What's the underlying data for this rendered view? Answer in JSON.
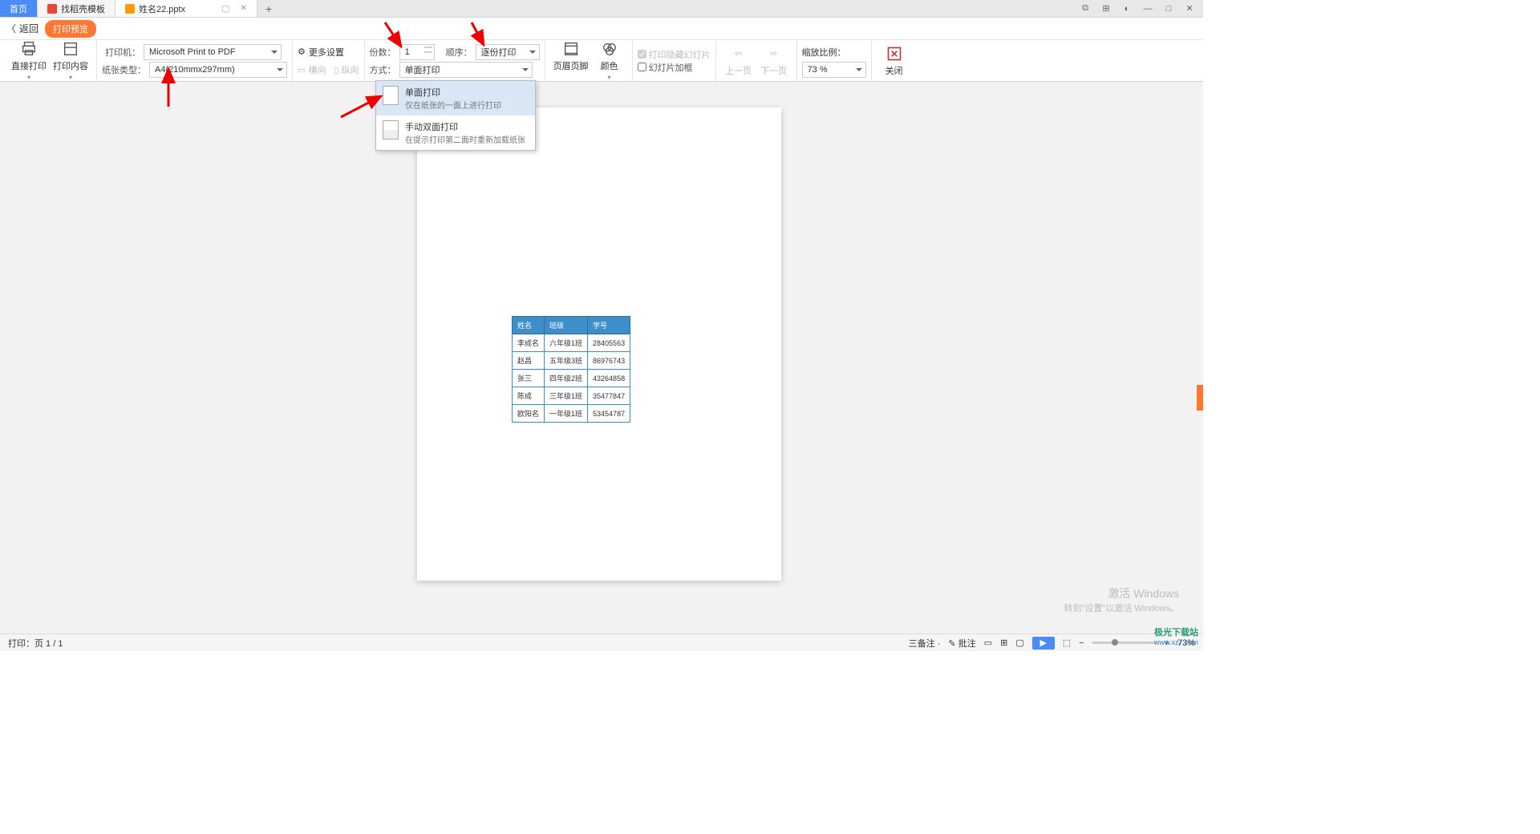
{
  "tabs": {
    "home": "首页",
    "template": "找稻壳模板",
    "active_file": "姓名22.pptx"
  },
  "sub_header": {
    "back": "返回",
    "pill": "打印预览"
  },
  "ribbon": {
    "direct_print": "直接打印",
    "print_content": "打印内容",
    "printer_label": "打印机：",
    "printer_value": "Microsoft Print to PDF",
    "paper_label": "纸张类型：",
    "paper_value": "A4(210mmx297mm)",
    "more_settings": "更多设置",
    "landscape": "横向",
    "portrait": "纵向",
    "copies_label": "份数：",
    "copies_value": "1",
    "order_label": "顺序：",
    "order_value": "逐份打印",
    "mode_label": "方式：",
    "mode_value": "单面打印",
    "header_footer": "页眉页脚",
    "color": "颜色",
    "chk_hidden": "打印隐藏幻灯片",
    "chk_frame": "幻灯片加框",
    "prev_page": "上一页",
    "next_page": "下一页",
    "zoom_label": "缩放比例：",
    "zoom_value": "73 %",
    "close": "关闭"
  },
  "dd_menu": {
    "opt1_title": "单面打印",
    "opt1_desc": "仅在纸张的一面上进行打印",
    "opt2_title": "手动双面打印",
    "opt2_desc": "在提示打印第二面时重新加载纸张"
  },
  "table": {
    "headers": [
      "姓名",
      "班级",
      "学号"
    ],
    "rows": [
      [
        "李成名",
        "六年级1班",
        "28405563"
      ],
      [
        "赵昌",
        "五年级3班",
        "86976743"
      ],
      [
        "张三",
        "四年级2班",
        "43264858"
      ],
      [
        "陈成",
        "三年级1班",
        "35477847"
      ],
      [
        "欧阳名",
        "一年级1班",
        "53454787"
      ]
    ]
  },
  "status": {
    "page_info": "打印：页 1 / 1",
    "notes": "三备注 ·",
    "comments": "批注",
    "zoom": "73%"
  },
  "watermark": {
    "line1": "激活 Windows",
    "line2": "转到\"设置\"以激活 Windows。",
    "logo_a": "极光下载站",
    "logo_b": "www.xz7.com"
  }
}
